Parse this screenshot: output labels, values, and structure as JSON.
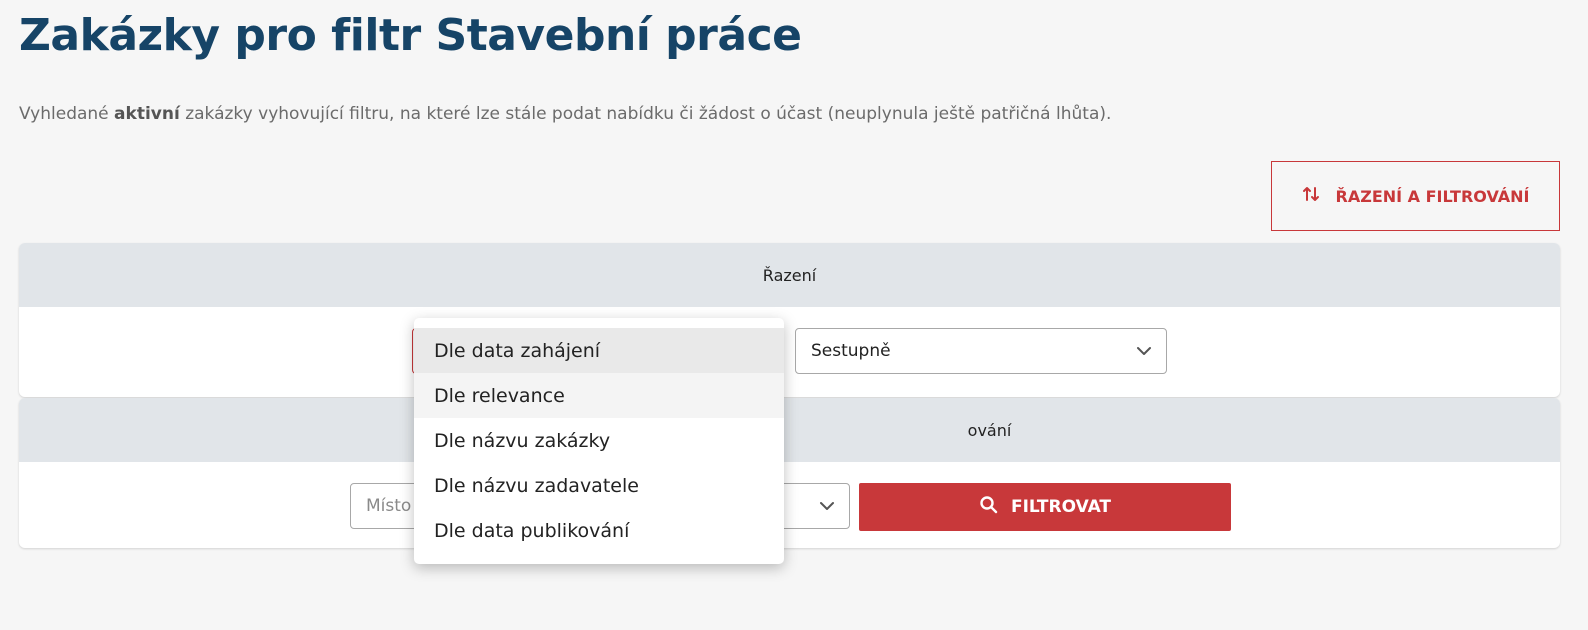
{
  "page": {
    "title": "Zakázky pro filtr Stavební práce",
    "intro_before": "Vyhledané ",
    "intro_bold": "aktivní",
    "intro_after": " zakázky vyhovující filtru, na které lze stále podat nabídku či žádost o účast (neuplynula ještě patřičná lhůta)."
  },
  "toolbar": {
    "sort_filter_label": "ŘAZENÍ A FILTROVÁNÍ",
    "sort_filter_icon": "sort-arrows-icon"
  },
  "sort_panel": {
    "header": "Řazení",
    "order_value": "Sestupně"
  },
  "filter_panel": {
    "header_suffix": "ování",
    "place_placeholder": "Místo",
    "filter_button_label": "FILTROVAT",
    "filter_button_icon": "search-icon"
  },
  "sort_dropdown": {
    "options": [
      "Dle data zahájení",
      "Dle relevance",
      "Dle názvu zakázky",
      "Dle názvu zadavatele",
      "Dle data publikování"
    ],
    "selected": "Dle data zahájení",
    "hovered": "Dle relevance"
  },
  "colors": {
    "title": "#164467",
    "accent": "#c8383a",
    "panel_header": "#e1e5e9",
    "background": "#f6f6f6"
  }
}
